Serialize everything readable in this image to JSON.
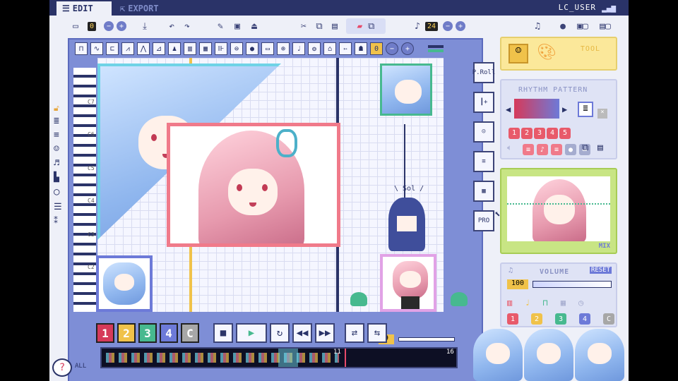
{
  "tabs": [
    {
      "label": "EDIT",
      "active": true
    },
    {
      "label": "EXPORT",
      "active": false
    }
  ],
  "user": "LC_USER",
  "toolbar": {
    "file_counter": "0",
    "tempo": "24"
  },
  "left_tools": [
    "lock-icon",
    "list-icon",
    "lines-icon",
    "face-icon",
    "note-icon",
    "stamp-icon",
    "circle-icon",
    "menu-icon",
    "star-list-icon"
  ],
  "octave_labels": [
    "C7",
    "C6",
    "C5",
    "C4",
    "C3",
    "C2"
  ],
  "sol_label": "\\ Sol /",
  "side_tools": [
    {
      "name": "piano-roll-tool",
      "label": "P.Roll"
    },
    {
      "name": "pulse-add-tool",
      "label": "┃+"
    },
    {
      "name": "face-tool",
      "label": "☺"
    },
    {
      "name": "layers-tool",
      "label": "≡"
    },
    {
      "name": "palette-tool",
      "label": "▦"
    },
    {
      "name": "pro-tool",
      "label": "PRO"
    }
  ],
  "tool_panel": {
    "title": "TOOL"
  },
  "rhythm": {
    "title": "RHYTHM PATTERN",
    "numbers": [
      "1",
      "2",
      "3",
      "4",
      "5"
    ]
  },
  "mix": {
    "label": "MIX"
  },
  "volume": {
    "title": "VOLUME",
    "reset": "RESET",
    "value": "100",
    "numbers": [
      "1",
      "2",
      "3",
      "4",
      "C"
    ]
  },
  "tracks": [
    {
      "label": "1",
      "color": "#d63a5a"
    },
    {
      "label": "2",
      "color": "#f0c24a"
    },
    {
      "label": "3",
      "color": "#47b98f"
    },
    {
      "label": "4",
      "color": "#6d7ad8"
    },
    {
      "label": "C",
      "color": "#a7a7a7"
    }
  ],
  "transport": [
    "■",
    "▶",
    "↻",
    "◀◀",
    "▶▶",
    "⇄",
    "⇆"
  ],
  "position": "9",
  "timeline": {
    "all_label": "ALL",
    "marker_left": "11",
    "marker_right": "16"
  },
  "colors": {
    "navy": "#2a3368",
    "panel": "#7e8ed6",
    "accent_pink": "#f07a8a",
    "accent_cyan": "#6fd3e6"
  }
}
